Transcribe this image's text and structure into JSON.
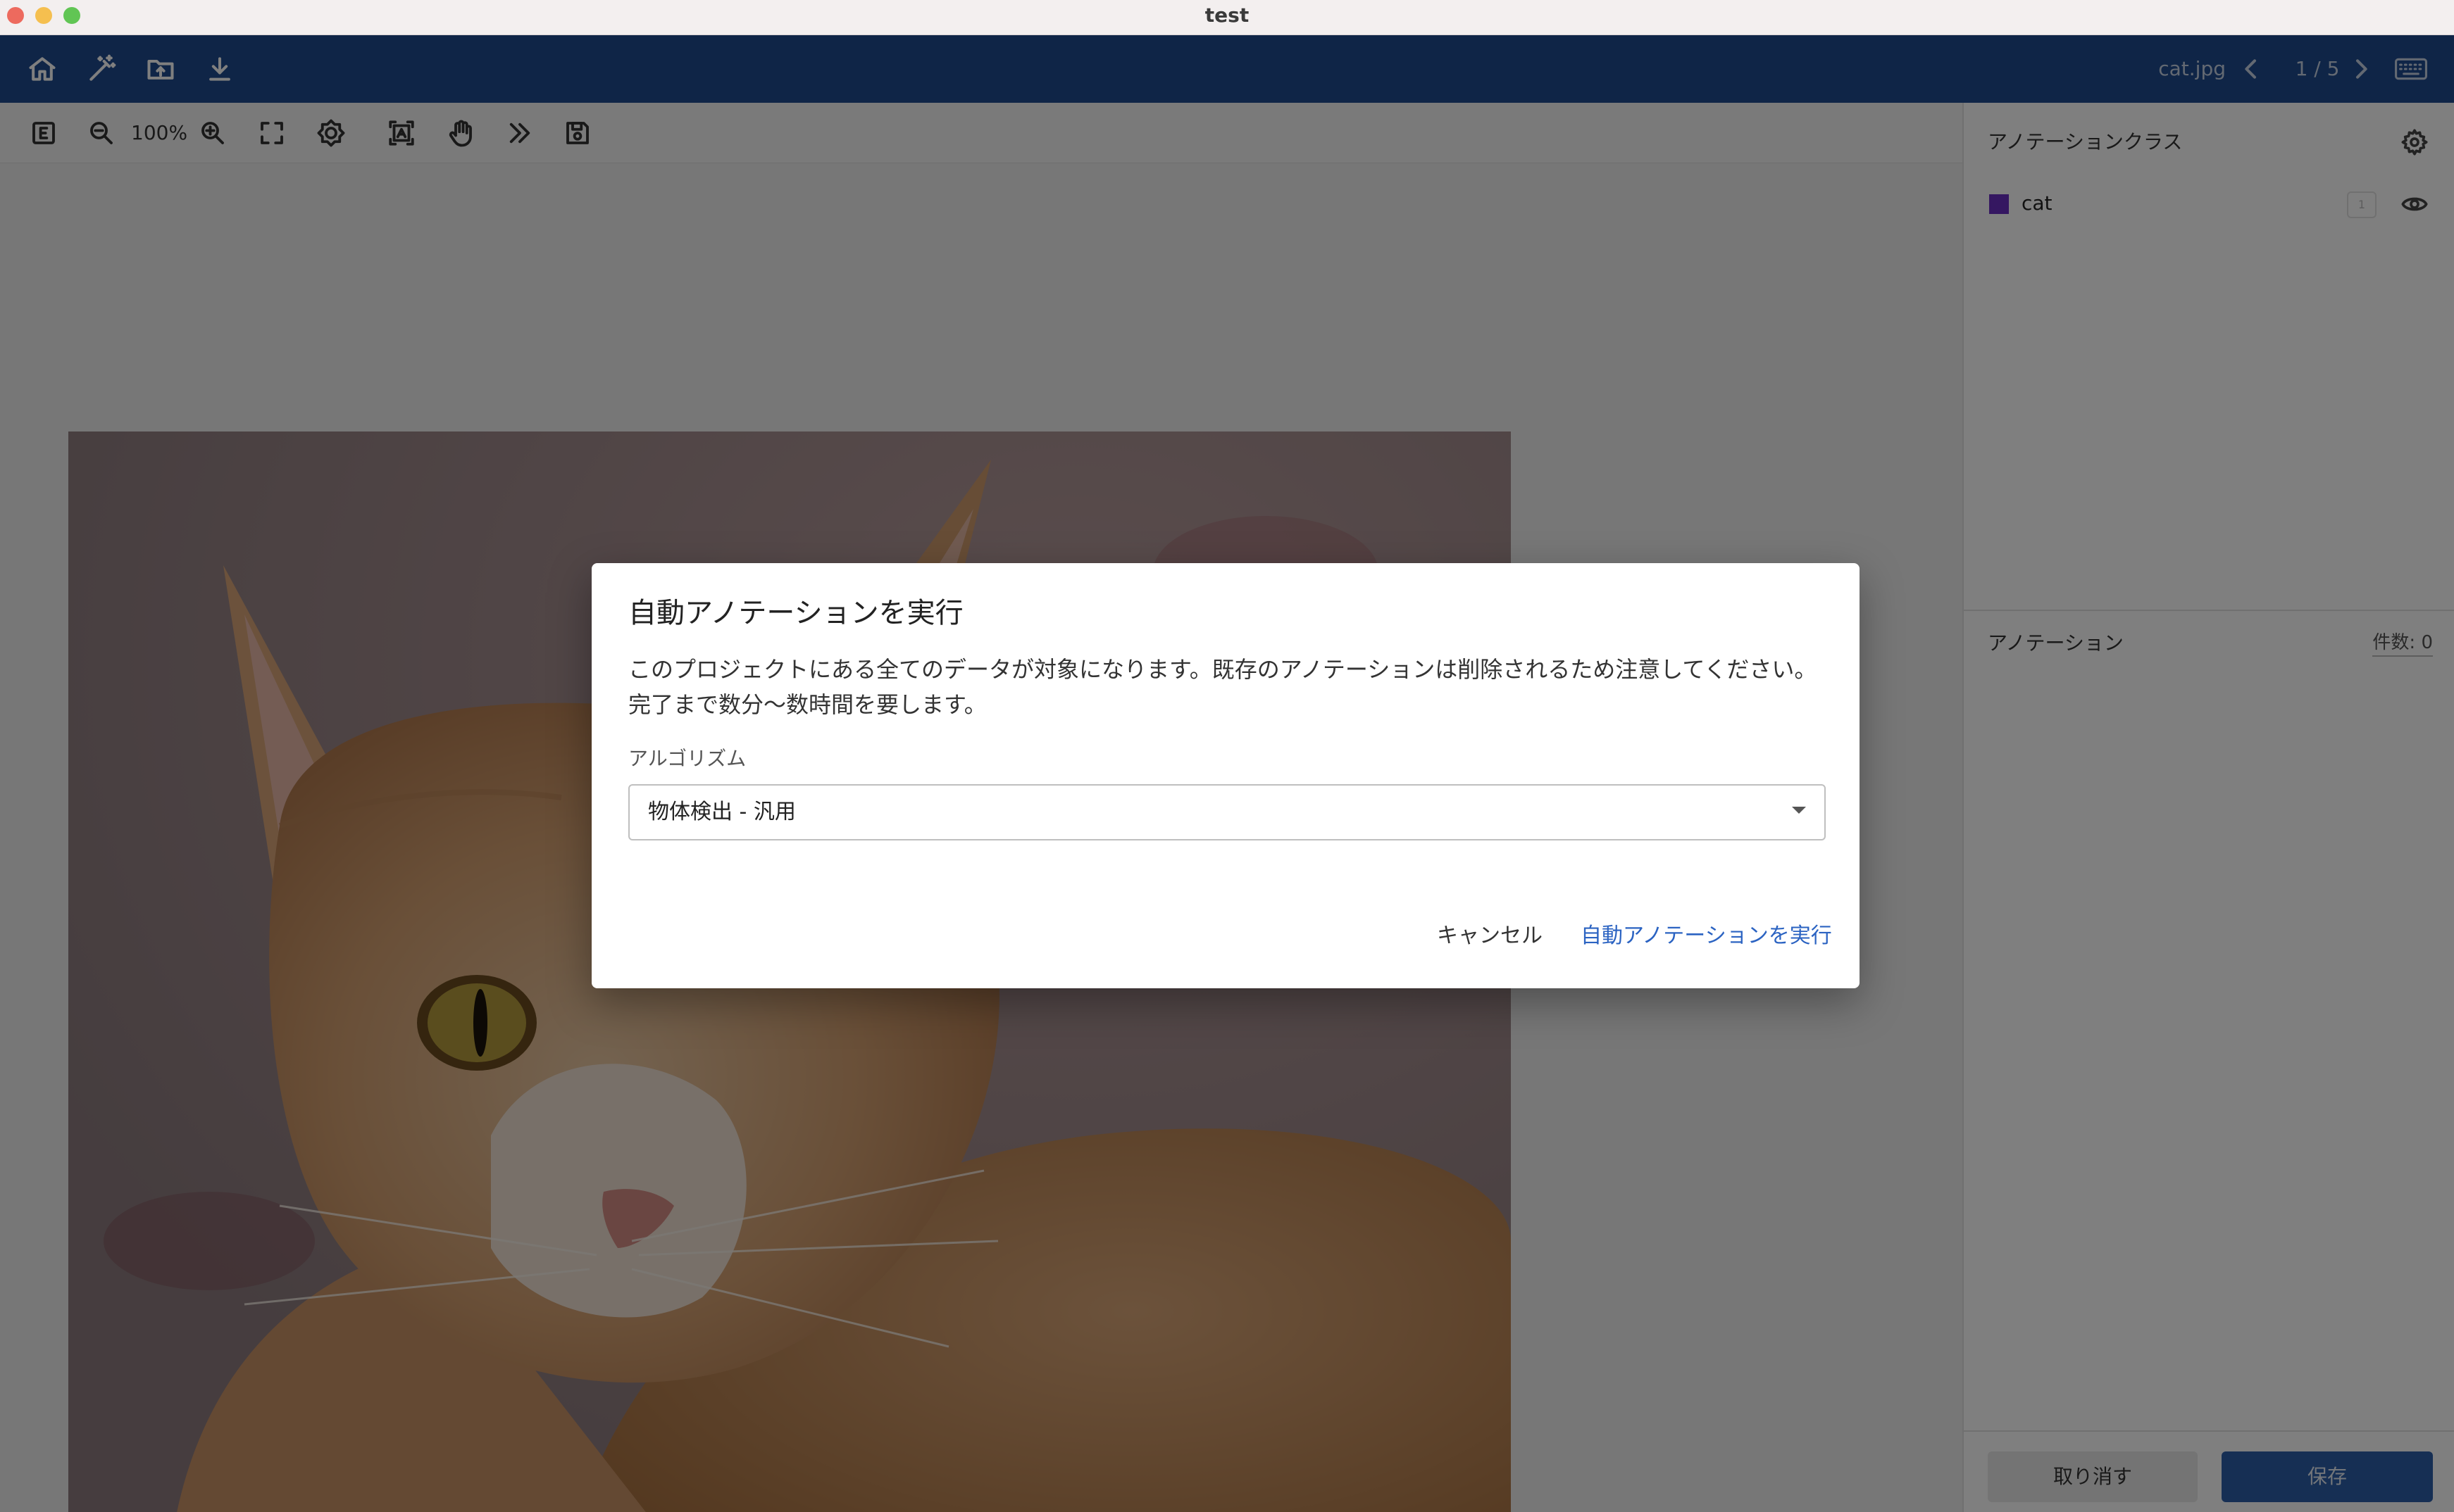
{
  "window": {
    "title": "test"
  },
  "appbar": {
    "icons": [
      "home-icon",
      "magic-wand-icon",
      "folder-upload-icon",
      "download-icon"
    ],
    "filename": "cat.jpg",
    "pager": "1 / 5",
    "right_icons": [
      "chevron-left-icon",
      "chevron-right-icon",
      "keyboard-icon"
    ]
  },
  "toolbar": {
    "zoom": "100%",
    "icons": [
      "edit-mode-icon",
      "zoom-out-icon",
      "zoom-in-icon",
      "fit-screen-icon",
      "brightness-icon",
      "text-box-icon",
      "pan-hand-icon",
      "double-chevron-right-icon",
      "save-icon"
    ]
  },
  "right_panel": {
    "classes_title": "アノテーションクラス",
    "classes": [
      {
        "label": "cat",
        "color": "#6a2fc2",
        "key": "1"
      }
    ],
    "annotations_title": "アノテーション",
    "annotations_count": "件数: 0",
    "undo_label": "取り消す",
    "save_label": "保存"
  },
  "dialog": {
    "title": "自動アノテーションを実行",
    "body_line1": "このプロジェクトにある全てのデータが対象になります。既存のアノテーションは削除されるため注意してください。",
    "body_line2": "完了まで数分〜数時間を要します。",
    "algorithm_label": "アルゴリズム",
    "algorithm_value": "物体検出 - 汎用",
    "cancel_label": "キャンセル",
    "run_label": "自動アノテーションを実行"
  },
  "colors": {
    "appbar": "#1e4b8e",
    "primary_text": "#2b63c2",
    "class_cat": "#6a2fc2"
  }
}
